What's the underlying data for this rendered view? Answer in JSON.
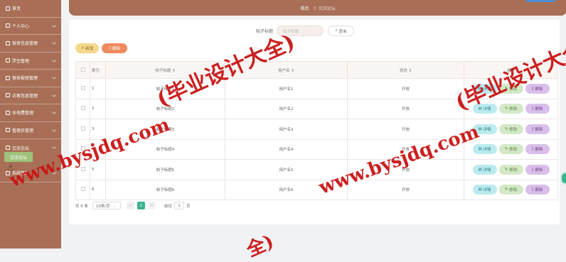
{
  "sidebar": {
    "items": [
      {
        "label": "首页"
      },
      {
        "label": "个人中心"
      },
      {
        "label": "宿舍信息管理"
      },
      {
        "label": "学生管理"
      },
      {
        "label": "宿舍报修管理"
      },
      {
        "label": "访客信息管理"
      },
      {
        "label": "水电费管理"
      },
      {
        "label": "管理员管理"
      },
      {
        "label": "交流论坛"
      }
    ],
    "sub_active": "交流论坛",
    "after_item": {
      "label": "系统管理"
    }
  },
  "breadcrumb": {
    "home": "首页",
    "current": "交流论坛"
  },
  "search": {
    "label": "帖子标题",
    "placeholder": "帖子标题",
    "button": "查询"
  },
  "actions": {
    "add": "新增",
    "delete": "删除"
  },
  "table": {
    "headers": {
      "index": "索引",
      "title": "帖子标题",
      "username": "用户名",
      "status": "状态",
      "ops": "操作"
    },
    "rows": [
      {
        "index": "1",
        "title": "帖子标题1",
        "username": "用户名1",
        "status": "开放"
      },
      {
        "index": "2",
        "title": "帖子标题2",
        "username": "用户名2",
        "status": "开放"
      },
      {
        "index": "3",
        "title": "帖子标题3",
        "username": "用户名3",
        "status": "开放"
      },
      {
        "index": "4",
        "title": "帖子标题4",
        "username": "用户名4",
        "status": "开放"
      },
      {
        "index": "5",
        "title": "帖子标题5",
        "username": "用户名5",
        "status": "开放"
      },
      {
        "index": "6",
        "title": "帖子标题6",
        "username": "用户名6",
        "status": "开放"
      }
    ],
    "op_labels": {
      "detail": "详情",
      "edit": "修改",
      "delete": "删除"
    }
  },
  "pagination": {
    "total": "共 6 条",
    "page_size": "10条/页",
    "prev": "<",
    "current": "1",
    "next": ">",
    "goto": "前往",
    "goto_value": "1",
    "page_unit": "页"
  },
  "watermark": {
    "text1": "(毕业设计大全)",
    "text2": "www.bysjdq.com",
    "text3": "全)"
  },
  "colors": {
    "sidebar": "#a86f56",
    "accent_green": "#3bb38f",
    "watermark": "#c81414"
  }
}
